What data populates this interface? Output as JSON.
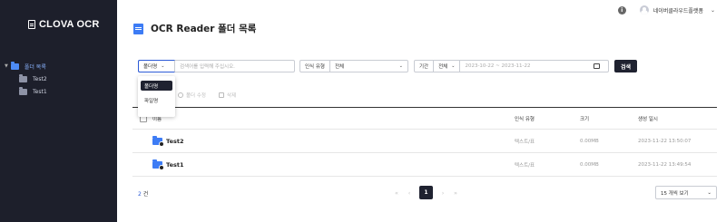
{
  "sidebar": {
    "brand": "CLOVA OCR",
    "tree": [
      {
        "label": "폴더 목록",
        "level": 0
      },
      {
        "label": "Test2",
        "level": 1
      },
      {
        "label": "Test1",
        "level": 1
      }
    ]
  },
  "header": {
    "info_icon": "i",
    "user_name": "네이버클라우드플랫폼",
    "user_chevron": "⌄"
  },
  "page": {
    "title": "OCR Reader 폴더 목록"
  },
  "search": {
    "scope_selected": "폴더명",
    "query_placeholder": "검색어를 입력해 주십시오.",
    "type_label": "인식 유형",
    "type_selected": "전체",
    "period_label": "기간",
    "period_selected": "전체",
    "date_range_placeholder": "2023-10-22 ~ 2023-11-22",
    "search_button": "검색",
    "scope_options": [
      "폴더명",
      "파일명"
    ],
    "scope_active_option": "폴더명"
  },
  "toolbar": {
    "edit_label": "폴더 수정",
    "delete_label": "삭제"
  },
  "table": {
    "headers": {
      "name": "이름",
      "type": "인식 유형",
      "size": "크기",
      "created": "생성 일시"
    },
    "rows": [
      {
        "name": "Test2",
        "type": "텍스트/표",
        "size": "0.00MB",
        "created": "2023-11-22 13:50:07"
      },
      {
        "name": "Test1",
        "type": "텍스트/표",
        "size": "0.00MB",
        "created": "2023-11-22 13:49:54"
      }
    ]
  },
  "footer": {
    "count_number": "2",
    "count_unit": "건",
    "first_page": "«",
    "prev_page": "‹",
    "current_page": "1",
    "next_page": "›",
    "last_page": "»",
    "per_page_label": "15 개씩 보기",
    "per_page_chevron": "⌄"
  },
  "colors": {
    "sidebar_bg": "#1d1f2b",
    "accent_blue": "#3d7cf5",
    "dark_button": "#1f2230"
  }
}
